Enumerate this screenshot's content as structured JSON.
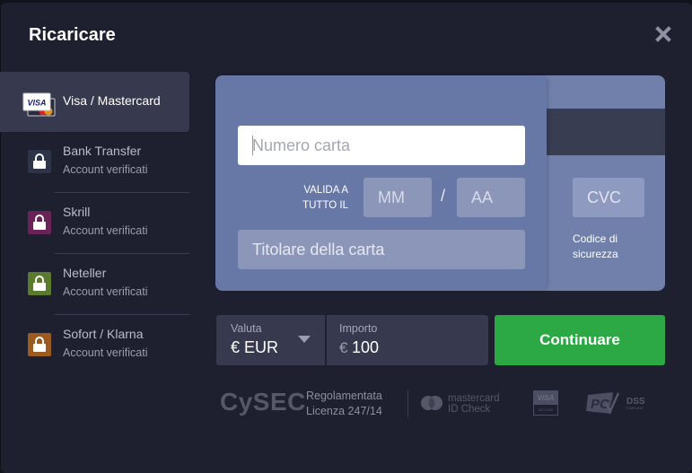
{
  "modal": {
    "title": "Ricaricare",
    "close_icon": "close-icon"
  },
  "sidebar": {
    "items": [
      {
        "name": "Visa / Mastercard",
        "sub": "",
        "icon": "visa-mastercard-icon",
        "color": "#ffffff",
        "active": true
      },
      {
        "name": "Bank Transfer",
        "sub": "Account verificati",
        "icon": "bank-lock-icon",
        "color": "#2e3548",
        "active": false
      },
      {
        "name": "Skrill",
        "sub": "Account verificati",
        "icon": "skrill-lock-icon",
        "color": "#6a2357",
        "active": false
      },
      {
        "name": "Neteller",
        "sub": "Account verificati",
        "icon": "neteller-lock-icon",
        "color": "#5a7a2e",
        "active": false
      },
      {
        "name": "Sofort / Klarna",
        "sub": "Account verificati",
        "icon": "sofort-lock-icon",
        "color": "#9a5a20",
        "active": false
      }
    ]
  },
  "card_form": {
    "card_number_placeholder": "Numero carta",
    "valid_until_label_1": "VALIDA A",
    "valid_until_label_2": "TUTTO IL",
    "month_placeholder": "MM",
    "separator": "/",
    "year_placeholder": "AA",
    "holder_placeholder": "Titolare della carta",
    "cvc_placeholder": "CVC",
    "cvc_label_1": "Codice di",
    "cvc_label_2": "sicurezza"
  },
  "payment": {
    "currency_label": "Valuta",
    "currency_value": "€ EUR",
    "amount_label": "Importo",
    "amount_currency": "€",
    "amount_value": "100",
    "continue_label": "Continuare",
    "continue_color": "#2ca844"
  },
  "footer": {
    "cysec": "CySEC",
    "regulated_1": "Regolamentata",
    "regulated_2": "Licenza 247/14",
    "mastercard_1": "mastercard",
    "mastercard_2": "ID Check",
    "visa_secure_top": "VISA",
    "visa_secure_bottom": "SECURE",
    "pci_text": "DSS",
    "pci_sub": "COMPLIANT"
  }
}
